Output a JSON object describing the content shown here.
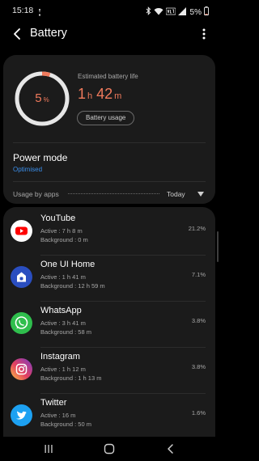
{
  "status_bar": {
    "time": "15:18",
    "battery_percent": "5%",
    "icons": [
      "notification-icon",
      "bluetooth-icon",
      "wifi-icon",
      "volte-icon",
      "signal-icon",
      "battery-icon"
    ]
  },
  "header": {
    "title": "Battery"
  },
  "summary": {
    "battery_level": 5,
    "battery_level_number": "5",
    "battery_level_unit": "%",
    "estimated_label": "Estimated battery life",
    "estimated_hours": "1",
    "estimated_hours_unit": "h",
    "estimated_minutes": "42",
    "estimated_minutes_unit": "m",
    "battery_usage_button": "Battery usage",
    "accent_color": "#f07a5c"
  },
  "power_mode": {
    "title": "Power mode",
    "value": "Optimised",
    "value_color": "#3b8eea"
  },
  "usage": {
    "label": "Usage by apps",
    "period": "Today"
  },
  "apps": [
    {
      "name": "YouTube",
      "icon": "youtube-icon",
      "active": "Active : 7 h 8 m",
      "background": "Background : 0 m",
      "percent": "21.2%",
      "icon_color": "#ffffff"
    },
    {
      "name": "One UI Home",
      "icon": "one-ui-home-icon",
      "active": "Active : 1 h 41 m",
      "background": "Background : 12 h 59 m",
      "percent": "7.1%",
      "icon_color": "#2a4ec0"
    },
    {
      "name": "WhatsApp",
      "icon": "whatsapp-icon",
      "active": "Active : 3 h 41 m",
      "background": "Background : 58 m",
      "percent": "3.8%",
      "icon_color": "#2fbe4d"
    },
    {
      "name": "Instagram",
      "icon": "instagram-icon",
      "active": "Active : 1 h 12 m",
      "background": "Background : 1 h 13 m",
      "percent": "3.8%",
      "icon_color": "#c13584"
    },
    {
      "name": "Twitter",
      "icon": "twitter-icon",
      "active": "Active : 16 m",
      "background": "Background : 50 m",
      "percent": "1.6%",
      "icon_color": "#1da1f2"
    }
  ],
  "nav_bar": {
    "buttons": [
      "recents-icon",
      "home-icon",
      "back-nav-icon"
    ]
  }
}
